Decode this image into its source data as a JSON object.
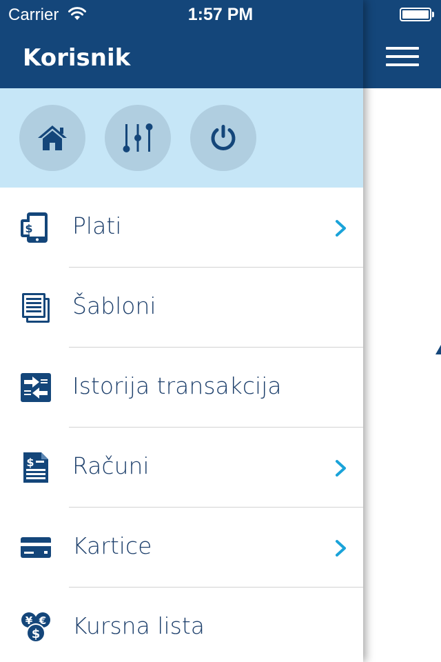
{
  "status_bar": {
    "carrier": "Carrier",
    "time": "1:57 PM"
  },
  "drawer": {
    "title": "Korisnik",
    "quick_actions": [
      {
        "icon": "home-icon"
      },
      {
        "icon": "sliders-icon"
      },
      {
        "icon": "power-icon"
      }
    ],
    "menu": [
      {
        "label": "Plati",
        "icon": "payment-device-icon",
        "has_chevron": true
      },
      {
        "label": "Šabloni",
        "icon": "documents-icon",
        "has_chevron": false
      },
      {
        "label": "Istorija transakcija",
        "icon": "transfer-arrows-icon",
        "has_chevron": false
      },
      {
        "label": "Računi",
        "icon": "invoice-icon",
        "has_chevron": true
      },
      {
        "label": "Kartice",
        "icon": "card-icon",
        "has_chevron": true
      },
      {
        "label": "Kursna lista",
        "icon": "currency-icon",
        "has_chevron": false
      }
    ]
  },
  "colors": {
    "header": "#14467a",
    "quick_bar": "#c6e6f7",
    "quick_button": "#b0cee0",
    "icon": "#14467a",
    "label": "#1d3f6b",
    "chevron": "#1aa3d9",
    "divider": "#d2d2d2"
  }
}
